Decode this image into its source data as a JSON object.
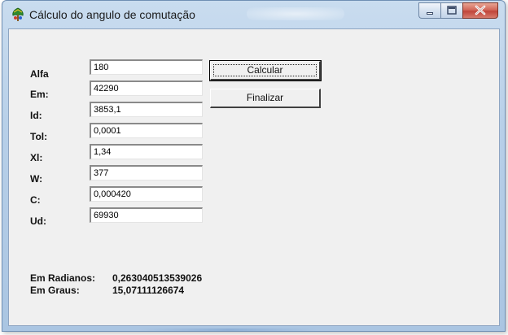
{
  "window": {
    "title": "Cálculo do angulo de comutação"
  },
  "caption_buttons": [
    "minimize-icon",
    "maximize-icon",
    "close-icon"
  ],
  "fields": [
    {
      "label": "Alfa",
      "value": "180"
    },
    {
      "label": "Em:",
      "value": "42290"
    },
    {
      "label": "Id:",
      "value": "3853,1"
    },
    {
      "label": "Tol:",
      "value": "0,0001"
    },
    {
      "label": "Xl:",
      "value": "1,34"
    },
    {
      "label": "W:",
      "value": "377"
    },
    {
      "label": "C:",
      "value": "0,000420"
    },
    {
      "label": "Ud:",
      "value": "69930"
    }
  ],
  "buttons": {
    "calcular": "Calcular",
    "finalizar": "Finalizar"
  },
  "results": {
    "radianos_label": "Em Radianos:",
    "radianos_value": "0,263040513539026",
    "graus_label": "Em Graus:",
    "graus_value": "15,07111126674"
  },
  "colors": {
    "titlebar": "#b7cfe8",
    "client": "#f0f0f0",
    "close_button": "#c0453a"
  }
}
